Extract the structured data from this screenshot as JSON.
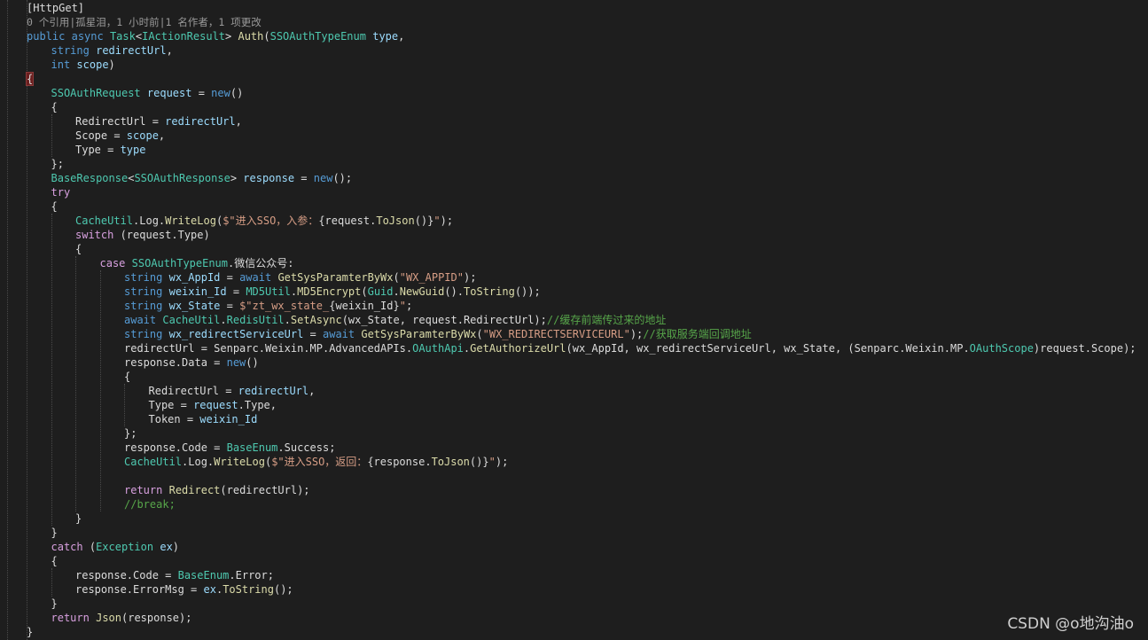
{
  "colors": {
    "background": "#1e1e1e",
    "keyword": "#569cd6",
    "control": "#d8a0df",
    "type": "#4ec9b0",
    "method": "#dcdcaa",
    "string": "#d69d85",
    "comment": "#57a64a",
    "plain": "#dcdcdc",
    "parameter": "#9cdcfe",
    "codelens": "#999999"
  },
  "watermark": "CSDN @o地沟油o",
  "lines": [
    {
      "indent": 1,
      "tokens": [
        {
          "t": "[HttpGet]",
          "c": "plain"
        }
      ]
    },
    {
      "indent": 1,
      "lens": true,
      "tokens": [
        {
          "t": "0 个引用|孤星泪，1 小时前|1 名作者，1 项更改",
          "c": "lens"
        }
      ]
    },
    {
      "indent": 1,
      "tokens": [
        {
          "t": "public",
          "c": "kw"
        },
        {
          "t": " "
        },
        {
          "t": "async",
          "c": "kw"
        },
        {
          "t": " "
        },
        {
          "t": "Task",
          "c": "type"
        },
        {
          "t": "<"
        },
        {
          "t": "IActionResult",
          "c": "type"
        },
        {
          "t": "> "
        },
        {
          "t": "Auth",
          "c": "method"
        },
        {
          "t": "("
        },
        {
          "t": "SSOAuthTypeEnum",
          "c": "type"
        },
        {
          "t": " "
        },
        {
          "t": "type",
          "c": "param"
        },
        {
          "t": ","
        }
      ]
    },
    {
      "indent": 2,
      "tokens": [
        {
          "t": "string",
          "c": "kw"
        },
        {
          "t": " "
        },
        {
          "t": "redirectUrl",
          "c": "param"
        },
        {
          "t": ","
        }
      ]
    },
    {
      "indent": 2,
      "tokens": [
        {
          "t": "int",
          "c": "kw"
        },
        {
          "t": " "
        },
        {
          "t": "scope",
          "c": "param"
        },
        {
          "t": ")"
        }
      ]
    },
    {
      "indent": 1,
      "tokens": [
        {
          "t": "{",
          "c": "brace-hl"
        }
      ]
    },
    {
      "indent": 2,
      "tokens": [
        {
          "t": "SSOAuthRequest",
          "c": "type"
        },
        {
          "t": " "
        },
        {
          "t": "request",
          "c": "param"
        },
        {
          "t": " = "
        },
        {
          "t": "new",
          "c": "kw"
        },
        {
          "t": "()"
        }
      ]
    },
    {
      "indent": 2,
      "tokens": [
        {
          "t": "{"
        }
      ]
    },
    {
      "indent": 3,
      "tokens": [
        {
          "t": "RedirectUrl = "
        },
        {
          "t": "redirectUrl",
          "c": "param"
        },
        {
          "t": ","
        }
      ]
    },
    {
      "indent": 3,
      "tokens": [
        {
          "t": "Scope = "
        },
        {
          "t": "scope",
          "c": "param"
        },
        {
          "t": ","
        }
      ]
    },
    {
      "indent": 3,
      "tokens": [
        {
          "t": "Type = "
        },
        {
          "t": "type",
          "c": "param"
        }
      ]
    },
    {
      "indent": 2,
      "tokens": [
        {
          "t": "};"
        }
      ]
    },
    {
      "indent": 2,
      "tokens": [
        {
          "t": "BaseResponse",
          "c": "type"
        },
        {
          "t": "<"
        },
        {
          "t": "SSOAuthResponse",
          "c": "type"
        },
        {
          "t": "> "
        },
        {
          "t": "response",
          "c": "param"
        },
        {
          "t": " = "
        },
        {
          "t": "new",
          "c": "kw"
        },
        {
          "t": "();"
        }
      ]
    },
    {
      "indent": 2,
      "tokens": [
        {
          "t": "try",
          "c": "ctrl"
        }
      ]
    },
    {
      "indent": 2,
      "tokens": [
        {
          "t": "{"
        }
      ]
    },
    {
      "indent": 3,
      "tokens": [
        {
          "t": "CacheUtil",
          "c": "type"
        },
        {
          "t": ".Log."
        },
        {
          "t": "WriteLog",
          "c": "method"
        },
        {
          "t": "("
        },
        {
          "t": "$\"进入SSO，入参：",
          "c": "str"
        },
        {
          "t": "{request."
        },
        {
          "t": "ToJson",
          "c": "method"
        },
        {
          "t": "()}"
        },
        {
          "t": "\"",
          "c": "str"
        },
        {
          "t": ");"
        }
      ]
    },
    {
      "indent": 3,
      "tokens": [
        {
          "t": "switch",
          "c": "ctrl"
        },
        {
          "t": " (request.Type)"
        }
      ]
    },
    {
      "indent": 3,
      "tokens": [
        {
          "t": "{"
        }
      ]
    },
    {
      "indent": 4,
      "tokens": [
        {
          "t": "case",
          "c": "ctrl"
        },
        {
          "t": " "
        },
        {
          "t": "SSOAuthTypeEnum",
          "c": "type"
        },
        {
          "t": ".微信公众号:"
        }
      ]
    },
    {
      "indent": 5,
      "tokens": [
        {
          "t": "string",
          "c": "kw"
        },
        {
          "t": " "
        },
        {
          "t": "wx_AppId",
          "c": "param"
        },
        {
          "t": " = "
        },
        {
          "t": "await",
          "c": "kw"
        },
        {
          "t": " "
        },
        {
          "t": "GetSysParamterByWx",
          "c": "method"
        },
        {
          "t": "("
        },
        {
          "t": "\"WX_APPID\"",
          "c": "str"
        },
        {
          "t": ");"
        }
      ]
    },
    {
      "indent": 5,
      "tokens": [
        {
          "t": "string",
          "c": "kw"
        },
        {
          "t": " "
        },
        {
          "t": "weixin_Id",
          "c": "param"
        },
        {
          "t": " = "
        },
        {
          "t": "MD5Util",
          "c": "type"
        },
        {
          "t": "."
        },
        {
          "t": "MD5Encrypt",
          "c": "method"
        },
        {
          "t": "("
        },
        {
          "t": "Guid",
          "c": "type"
        },
        {
          "t": "."
        },
        {
          "t": "NewGuid",
          "c": "method"
        },
        {
          "t": "()."
        },
        {
          "t": "ToString",
          "c": "method"
        },
        {
          "t": "());"
        }
      ]
    },
    {
      "indent": 5,
      "tokens": [
        {
          "t": "string",
          "c": "kw"
        },
        {
          "t": " "
        },
        {
          "t": "wx_State",
          "c": "param"
        },
        {
          "t": " = "
        },
        {
          "t": "$\"zt_wx_state_",
          "c": "str"
        },
        {
          "t": "{weixin_Id}"
        },
        {
          "t": "\"",
          "c": "str"
        },
        {
          "t": ";"
        }
      ]
    },
    {
      "indent": 5,
      "tokens": [
        {
          "t": "await",
          "c": "kw"
        },
        {
          "t": " "
        },
        {
          "t": "CacheUtil",
          "c": "type"
        },
        {
          "t": "."
        },
        {
          "t": "RedisUtil",
          "c": "type"
        },
        {
          "t": "."
        },
        {
          "t": "SetAsync",
          "c": "method"
        },
        {
          "t": "(wx_State, request.RedirectUrl);"
        },
        {
          "t": "//缓存前端传过来的地址",
          "c": "comment"
        }
      ]
    },
    {
      "indent": 5,
      "tokens": [
        {
          "t": "string",
          "c": "kw"
        },
        {
          "t": " "
        },
        {
          "t": "wx_redirectServiceUrl",
          "c": "param"
        },
        {
          "t": " = "
        },
        {
          "t": "await",
          "c": "kw"
        },
        {
          "t": " "
        },
        {
          "t": "GetSysParamterByWx",
          "c": "method"
        },
        {
          "t": "("
        },
        {
          "t": "\"WX_REDIRECTSERVICEURL\"",
          "c": "str"
        },
        {
          "t": ");"
        },
        {
          "t": "//获取服务端回调地址",
          "c": "comment"
        }
      ]
    },
    {
      "indent": 5,
      "tokens": [
        {
          "t": "redirectUrl = Senparc.Weixin.MP.AdvancedAPIs."
        },
        {
          "t": "OAuthApi",
          "c": "type"
        },
        {
          "t": "."
        },
        {
          "t": "GetAuthorizeUrl",
          "c": "method"
        },
        {
          "t": "(wx_AppId, wx_redirectServiceUrl, wx_State, (Senparc.Weixin.MP."
        },
        {
          "t": "OAuthScope",
          "c": "type"
        },
        {
          "t": ")request.Scope);"
        }
      ]
    },
    {
      "indent": 5,
      "tokens": [
        {
          "t": "response.Data = "
        },
        {
          "t": "new",
          "c": "kw"
        },
        {
          "t": "()"
        }
      ]
    },
    {
      "indent": 5,
      "tokens": [
        {
          "t": "{"
        }
      ]
    },
    {
      "indent": 6,
      "tokens": [
        {
          "t": "RedirectUrl = "
        },
        {
          "t": "redirectUrl",
          "c": "param"
        },
        {
          "t": ","
        }
      ]
    },
    {
      "indent": 6,
      "tokens": [
        {
          "t": "Type = "
        },
        {
          "t": "request",
          "c": "param"
        },
        {
          "t": ".Type,"
        }
      ]
    },
    {
      "indent": 6,
      "tokens": [
        {
          "t": "Token = "
        },
        {
          "t": "weixin_Id",
          "c": "param"
        }
      ]
    },
    {
      "indent": 5,
      "tokens": [
        {
          "t": "};"
        }
      ]
    },
    {
      "indent": 5,
      "tokens": [
        {
          "t": "response.Code = "
        },
        {
          "t": "BaseEnum",
          "c": "type"
        },
        {
          "t": ".Success;"
        }
      ]
    },
    {
      "indent": 5,
      "tokens": [
        {
          "t": "CacheUtil",
          "c": "type"
        },
        {
          "t": ".Log."
        },
        {
          "t": "WriteLog",
          "c": "method"
        },
        {
          "t": "("
        },
        {
          "t": "$\"进入SSO，返回：",
          "c": "str"
        },
        {
          "t": "{response."
        },
        {
          "t": "ToJson",
          "c": "method"
        },
        {
          "t": "()}"
        },
        {
          "t": "\"",
          "c": "str"
        },
        {
          "t": ");"
        }
      ]
    },
    {
      "indent": 5,
      "tokens": []
    },
    {
      "indent": 5,
      "tokens": [
        {
          "t": "return",
          "c": "ctrl"
        },
        {
          "t": " "
        },
        {
          "t": "Redirect",
          "c": "method"
        },
        {
          "t": "(redirectUrl);"
        }
      ]
    },
    {
      "indent": 5,
      "tokens": [
        {
          "t": "//break;",
          "c": "comment"
        }
      ]
    },
    {
      "indent": 3,
      "tokens": [
        {
          "t": "}"
        }
      ]
    },
    {
      "indent": 2,
      "tokens": [
        {
          "t": "}"
        }
      ]
    },
    {
      "indent": 2,
      "tokens": [
        {
          "t": "catch",
          "c": "ctrl"
        },
        {
          "t": " ("
        },
        {
          "t": "Exception",
          "c": "type"
        },
        {
          "t": " "
        },
        {
          "t": "ex",
          "c": "param"
        },
        {
          "t": ")"
        }
      ]
    },
    {
      "indent": 2,
      "tokens": [
        {
          "t": "{"
        }
      ]
    },
    {
      "indent": 3,
      "tokens": [
        {
          "t": "response.Code = "
        },
        {
          "t": "BaseEnum",
          "c": "type"
        },
        {
          "t": ".Error;"
        }
      ]
    },
    {
      "indent": 3,
      "tokens": [
        {
          "t": "response.ErrorMsg = "
        },
        {
          "t": "ex",
          "c": "param"
        },
        {
          "t": "."
        },
        {
          "t": "ToString",
          "c": "method"
        },
        {
          "t": "();"
        }
      ]
    },
    {
      "indent": 2,
      "tokens": [
        {
          "t": "}"
        }
      ]
    },
    {
      "indent": 2,
      "tokens": [
        {
          "t": "return",
          "c": "ctrl"
        },
        {
          "t": " "
        },
        {
          "t": "Json",
          "c": "method"
        },
        {
          "t": "(response);"
        }
      ]
    },
    {
      "indent": 1,
      "tokens": [
        {
          "t": "}"
        }
      ]
    }
  ]
}
